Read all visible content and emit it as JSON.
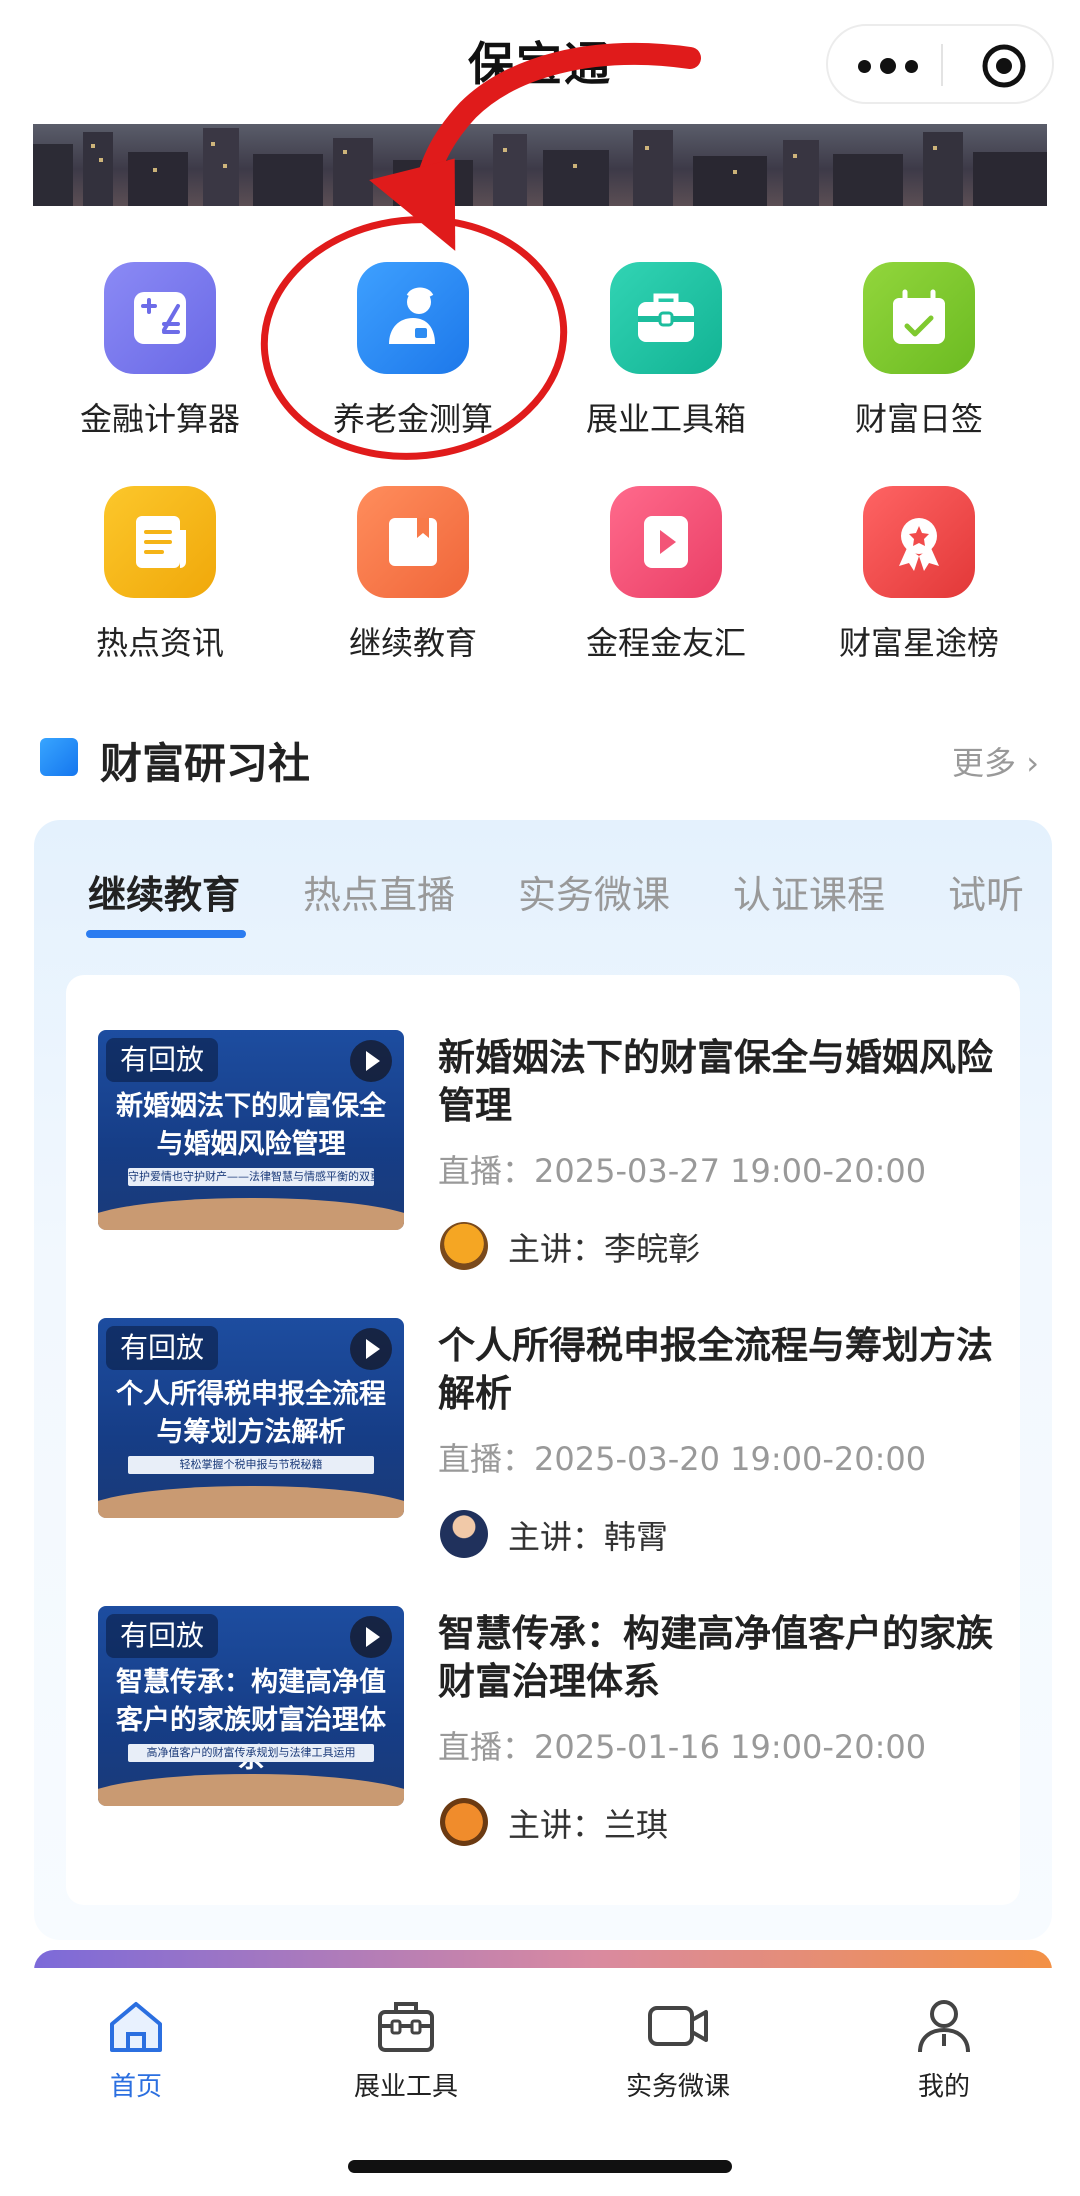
{
  "header": {
    "title": "保宝通"
  },
  "grid": [
    {
      "label": "金融计算器",
      "icon": "calculator-icon",
      "color": "#7a79ee"
    },
    {
      "label": "养老金测算",
      "icon": "pension-person-icon",
      "color": "#2d8cf2"
    },
    {
      "label": "展业工具箱",
      "icon": "toolbox-icon",
      "color": "#22c4a6"
    },
    {
      "label": "财富日签",
      "icon": "calendar-check-icon",
      "color": "#7fc92f"
    },
    {
      "label": "热点资讯",
      "icon": "news-icon",
      "color": "#f5b417"
    },
    {
      "label": "继续教育",
      "icon": "book-icon",
      "color": "#f87a49"
    },
    {
      "label": "金程金友汇",
      "icon": "play-icon",
      "color": "#f35477"
    },
    {
      "label": "财富星途榜",
      "icon": "award-ribbon-icon",
      "color": "#f14b4b"
    }
  ],
  "section": {
    "title": "财富研习社",
    "more": "更多"
  },
  "tabs": [
    {
      "label": "继续教育"
    },
    {
      "label": "热点直播"
    },
    {
      "label": "实务微课"
    },
    {
      "label": "认证课程"
    },
    {
      "label": "试听"
    }
  ],
  "courses": [
    {
      "badge": "有回放",
      "thumb_title": "新婚姻法下的财富保全与婚姻风险管理",
      "thumb_sub": "守护爱情也守护财产——法律智慧与情感平衡的双重法则",
      "title": "新婚姻法下的财富保全与婚姻风险管理",
      "date": "直播：2025-03-27  19:00-20:00",
      "speaker": "主讲：李皖彰"
    },
    {
      "badge": "有回放",
      "thumb_title": "个人所得税申报全流程与筹划方法解析",
      "thumb_sub": "轻松掌握个税申报与节税秘籍",
      "title": "个人所得税申报全流程与筹划方法解析",
      "date": "直播：2025-03-20  19:00-20:00",
      "speaker": "主讲：韩霄"
    },
    {
      "badge": "有回放",
      "thumb_title": "智慧传承：构建高净值客户的家族财富治理体系",
      "thumb_sub": "高净值客户的财富传承规划与法律工具运用",
      "title": "智慧传承：构建高净值客户的家族财富治理体系",
      "date": "直播：2025-01-16  19:00-20:00",
      "speaker": "主讲：兰琪"
    }
  ],
  "tabbar": [
    {
      "label": "首页",
      "icon": "home-icon"
    },
    {
      "label": "展业工具",
      "icon": "toolbox-icon"
    },
    {
      "label": "实务微课",
      "icon": "video-camera-icon"
    },
    {
      "label": "我的",
      "icon": "user-icon"
    }
  ],
  "colors": {
    "accent": "#2b6fe0",
    "annotation": "#e01b1b"
  }
}
